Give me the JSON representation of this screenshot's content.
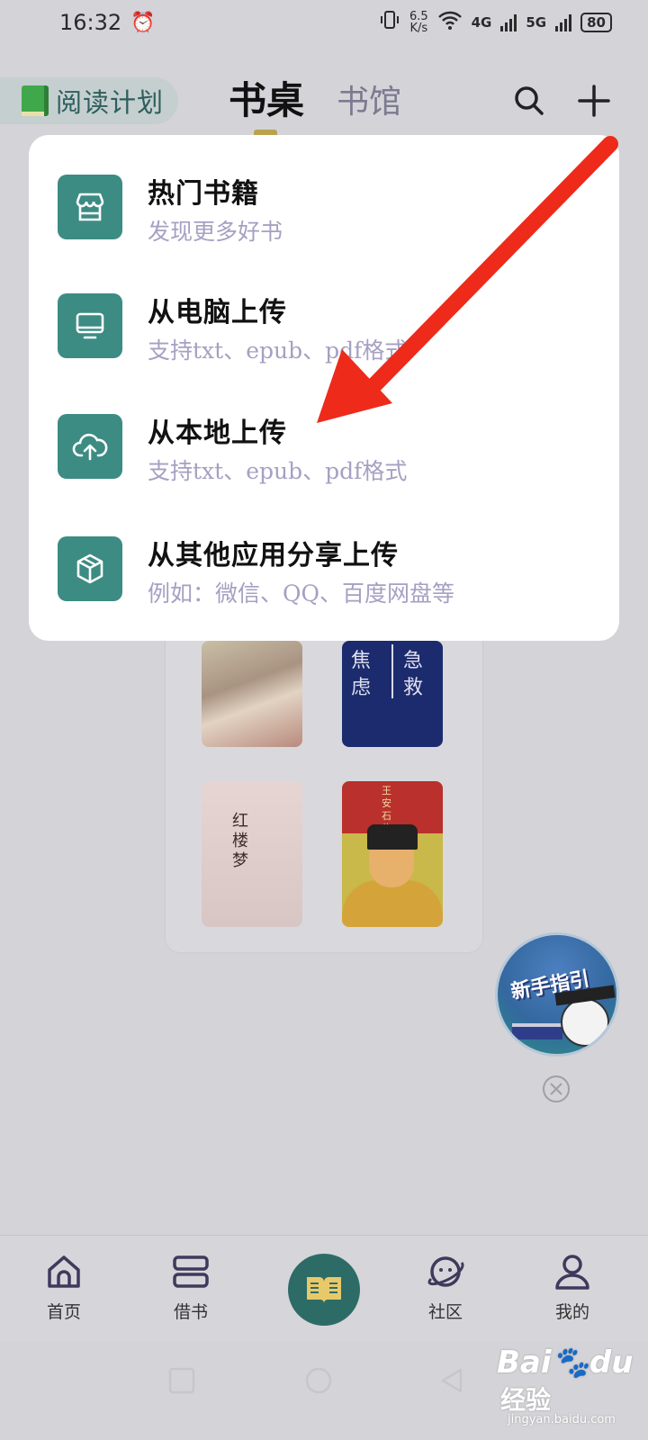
{
  "status_bar": {
    "time": "16:32",
    "net_speed_value": "6.5",
    "net_speed_unit": "K/s",
    "sig1": "4G",
    "sig2": "5G",
    "battery": "80"
  },
  "header": {
    "reading_plan": "阅读计划",
    "tabs": [
      {
        "label": "书桌",
        "active": true
      },
      {
        "label": "书馆",
        "active": false
      }
    ],
    "accent_color": "#b9a24c"
  },
  "shelf": {
    "covers": [
      {
        "title": ""
      },
      {
        "title_left": "焦虑",
        "title_right": "急救"
      },
      {
        "title": "红楼梦"
      },
      {
        "title": "王安石传"
      }
    ]
  },
  "menu": {
    "items": [
      {
        "title": "热门书籍",
        "subtitle": "发现更多好书",
        "icon": "store-icon"
      },
      {
        "title": "从电脑上传",
        "subtitle": "支持txt、epub、pdf格式",
        "icon": "monitor-icon"
      },
      {
        "title": "从本地上传",
        "subtitle": "支持txt、epub、pdf格式",
        "icon": "cloud-upload-icon"
      },
      {
        "title": "从其他应用分享上传",
        "subtitle": "例如：微信、QQ、百度网盘等",
        "icon": "cube-icon"
      }
    ],
    "icon_bg": "#3c8c83"
  },
  "guide": {
    "label": "新手指引"
  },
  "bottom_nav": {
    "items": [
      {
        "label": "首页",
        "icon": "home-icon"
      },
      {
        "label": "借书",
        "icon": "borrow-icon"
      },
      {
        "label": "",
        "icon": "open-book-icon"
      },
      {
        "label": "社区",
        "icon": "planet-icon"
      },
      {
        "label": "我的",
        "icon": "user-icon"
      }
    ],
    "center_color": "#2d6b66"
  },
  "watermark": {
    "logo_a": "Bai",
    "logo_b": "du",
    "text": "经验",
    "url": "jingyan.baidu.com"
  },
  "annotation": {
    "arrow_color": "#ee2a1a"
  }
}
